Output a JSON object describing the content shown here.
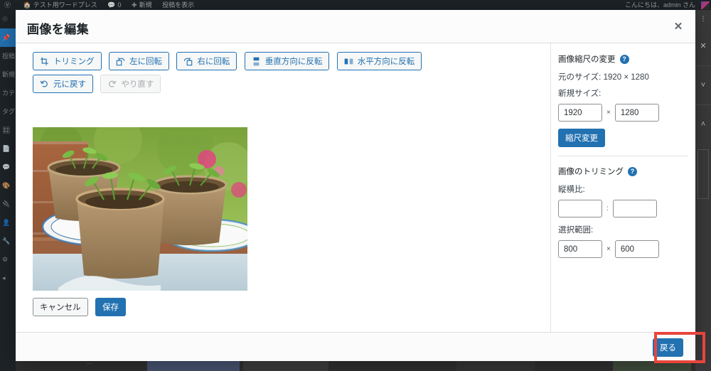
{
  "adminbar": {
    "logo_icon": "wordpress-icon",
    "site_icon": "home-icon",
    "site_name": "テスト用ワードプレス",
    "comments_icon": "comment-bubble-icon",
    "comments_count": "0",
    "new_icon": "plus-icon",
    "new_label": "新規",
    "view_post_label": "投稿を表示",
    "greeting": "こんにちは、admin さん"
  },
  "sidebar": {
    "items": [
      {
        "label": "",
        "icon": "dashboard-icon"
      },
      {
        "label": "",
        "icon": "pin-icon",
        "current": true
      },
      {
        "label": "投稿",
        "icon": "post-icon"
      },
      {
        "label": "新規",
        "icon": "new-icon"
      },
      {
        "label": "カテ",
        "icon": "category-icon"
      },
      {
        "label": "タグ",
        "icon": "tag-icon"
      },
      {
        "label": "",
        "icon": "media-icon"
      },
      {
        "label": "",
        "icon": "page-icon"
      },
      {
        "label": "",
        "icon": "comment-icon"
      },
      {
        "label": "",
        "icon": "appearance-icon"
      },
      {
        "label": "",
        "icon": "plugins-icon"
      },
      {
        "label": "",
        "icon": "users-icon"
      },
      {
        "label": "",
        "icon": "tools-icon"
      },
      {
        "label": "",
        "icon": "settings-icon"
      },
      {
        "label": "",
        "icon": "collapse-icon"
      }
    ]
  },
  "right_rail": {
    "dots_icon": "more-vertical-icon",
    "close_icon": "close-icon",
    "down_icon": "chevron-down-icon",
    "up_icon": "chevron-up-icon"
  },
  "modal": {
    "title": "画像を編集",
    "close_icon": "close-icon"
  },
  "toolbar": {
    "crop": {
      "label": "トリミング",
      "icon": "crop-icon",
      "disabled": false
    },
    "rotate_left": {
      "label": "左に回転",
      "icon": "rotate-left-icon",
      "disabled": false
    },
    "rotate_right": {
      "label": "右に回転",
      "icon": "rotate-right-icon",
      "disabled": false
    },
    "flip_vertical": {
      "label": "垂直方向に反転",
      "icon": "flip-vertical-icon",
      "disabled": false
    },
    "flip_horizontal": {
      "label": "水平方向に反転",
      "icon": "flip-horizontal-icon",
      "disabled": false
    },
    "undo": {
      "label": "元に戻す",
      "icon": "undo-icon",
      "disabled": false
    },
    "redo": {
      "label": "やり直す",
      "icon": "redo-icon",
      "disabled": true
    }
  },
  "preview": {
    "alt": "苗が植えられた3つのピートポットの写真",
    "icon": "image-thumbnail"
  },
  "actions": {
    "cancel_label": "キャンセル",
    "save_label": "保存"
  },
  "settings": {
    "scale": {
      "heading": "画像縮尺の変更",
      "help_icon": "help-icon",
      "original_size_label": "元のサイズ:",
      "original_size_value": "1920 × 1280",
      "new_size_label": "新規サイズ:",
      "width_value": "1920",
      "height_value": "1280",
      "separator": "×",
      "button_label": "縮尺変更"
    },
    "crop": {
      "heading": "画像のトリミング",
      "help_icon": "help-icon",
      "aspect_label": "縦横比:",
      "aspect_w": "",
      "aspect_h": "",
      "aspect_separator": ":",
      "selection_label": "選択範囲:",
      "selection_w": "800",
      "selection_h": "600",
      "selection_separator": "×"
    }
  },
  "footer": {
    "back_label": "戻る"
  },
  "annotation": {
    "color": "#e8453c",
    "target": "back-button"
  }
}
